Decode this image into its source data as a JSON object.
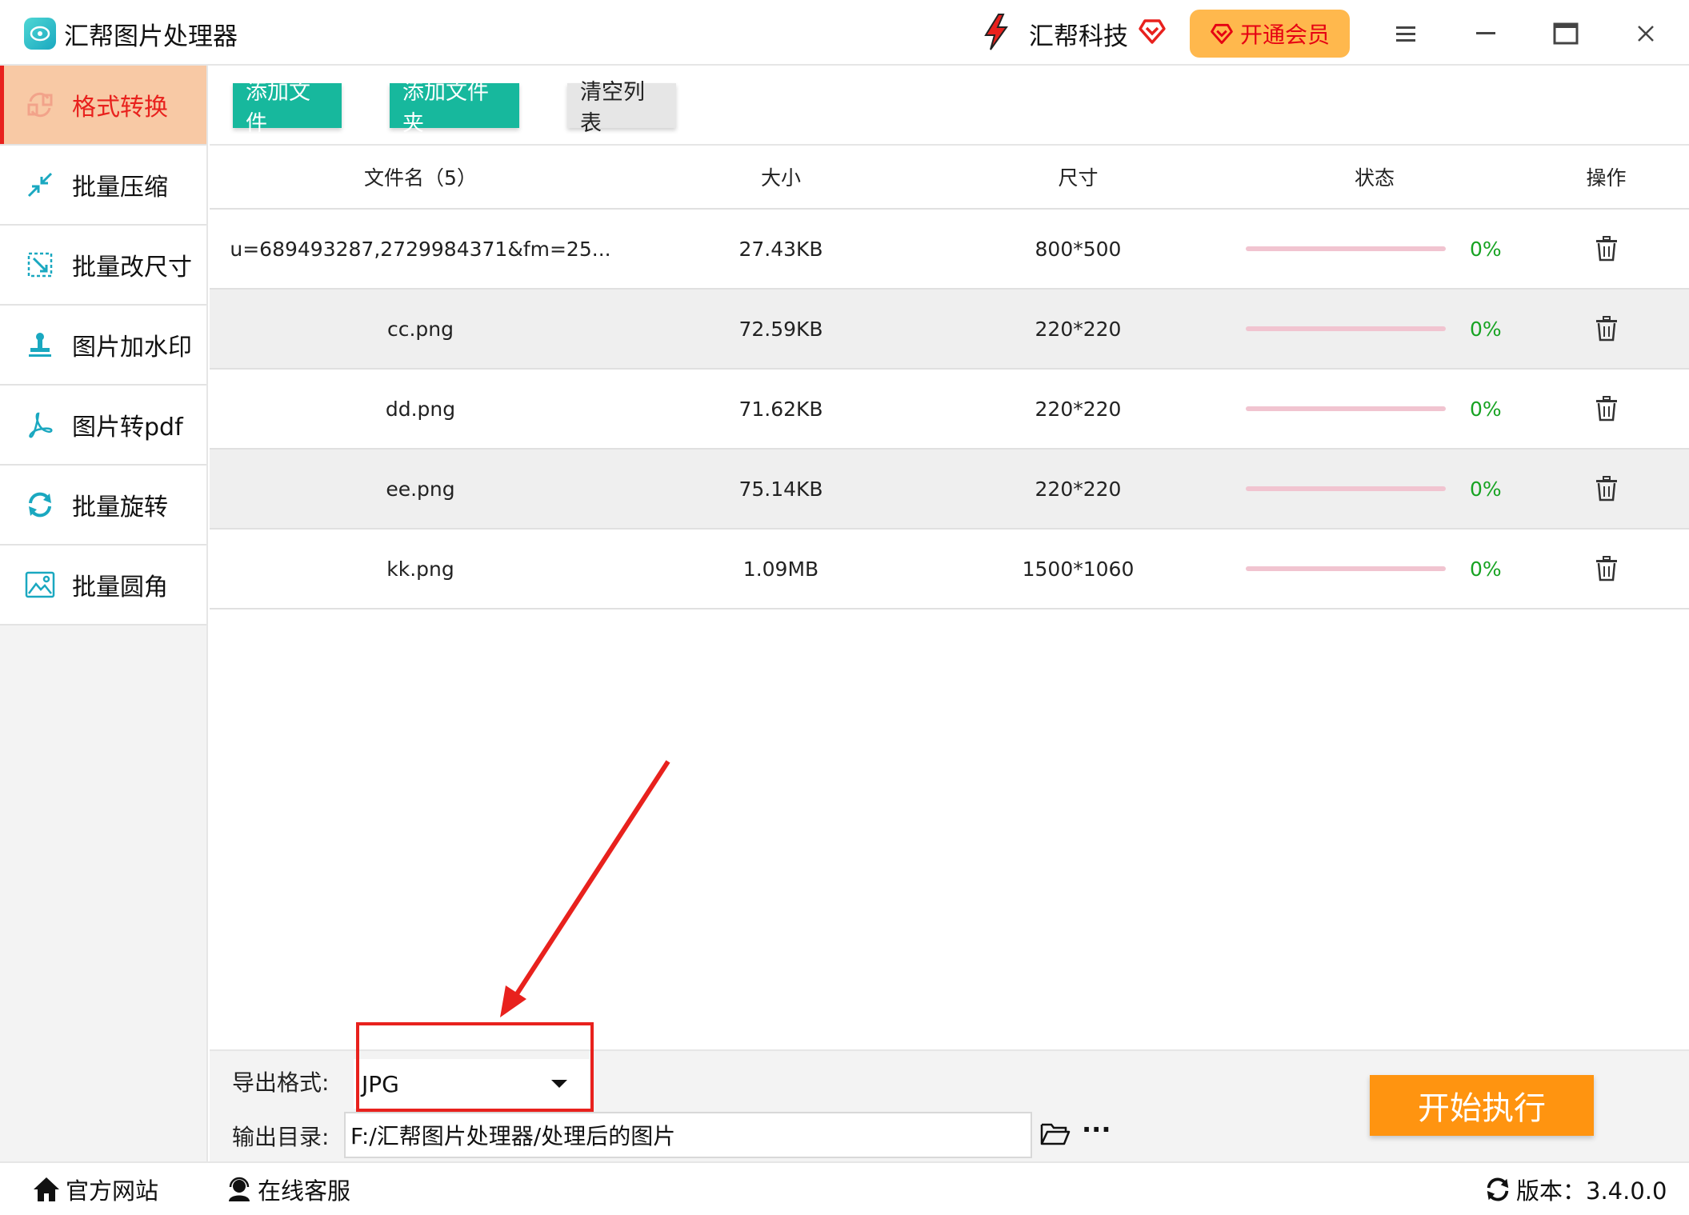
{
  "titlebar": {
    "app_title": "汇帮图片处理器",
    "brand_name": "汇帮科技",
    "vip_label": "开通会员",
    "icons": [
      "app-logo-icon",
      "brand-lightning-icon",
      "heart-icon",
      "menu-icon",
      "minimize-icon",
      "maximize-icon",
      "close-icon"
    ]
  },
  "sidebar": {
    "items": [
      {
        "label": "格式转换",
        "icon": "format-convert-icon",
        "active": true
      },
      {
        "label": "批量压缩",
        "icon": "compress-icon"
      },
      {
        "label": "批量改尺寸",
        "icon": "resize-icon"
      },
      {
        "label": "图片加水印",
        "icon": "watermark-icon"
      },
      {
        "label": "图片转pdf",
        "icon": "pdf-icon"
      },
      {
        "label": "批量旋转",
        "icon": "rotate-icon"
      },
      {
        "label": "批量圆角",
        "icon": "rounded-corner-icon"
      }
    ]
  },
  "toolbar": {
    "add_file": "添加文件",
    "add_folder": "添加文件夹",
    "clear_list": "清空列表"
  },
  "table": {
    "headers": {
      "name": "文件名（5）",
      "size": "大小",
      "dimension": "尺寸",
      "status": "状态",
      "action": "操作"
    },
    "rows": [
      {
        "name": "u=689493287,2729984371&fm=25...",
        "size": "27.43KB",
        "dimension": "800*500",
        "progress": 0,
        "progress_label": "0%"
      },
      {
        "name": "cc.png",
        "size": "72.59KB",
        "dimension": "220*220",
        "progress": 0,
        "progress_label": "0%"
      },
      {
        "name": "dd.png",
        "size": "71.62KB",
        "dimension": "220*220",
        "progress": 0,
        "progress_label": "0%"
      },
      {
        "name": "ee.png",
        "size": "75.14KB",
        "dimension": "220*220",
        "progress": 0,
        "progress_label": "0%"
      },
      {
        "name": "kk.png",
        "size": "1.09MB",
        "dimension": "1500*1060",
        "progress": 0,
        "progress_label": "0%"
      }
    ]
  },
  "bottom": {
    "format_label": "导出格式:",
    "format_value": "JPG",
    "outdir_label": "输出目录:",
    "outdir_value": "F:/汇帮图片处理器/处理后的图片",
    "more_label": "···",
    "start_label": "开始执行"
  },
  "footer": {
    "website": "官方网站",
    "support": "在线客服",
    "version": "版本：3.4.0.0"
  },
  "colors": {
    "accent_red": "#e8211d",
    "teal": "#17b89d",
    "orange": "#ff9410",
    "vip_bg": "#ffb84d",
    "active_bg": "#f8c9a5",
    "progress_green": "#17a322"
  }
}
